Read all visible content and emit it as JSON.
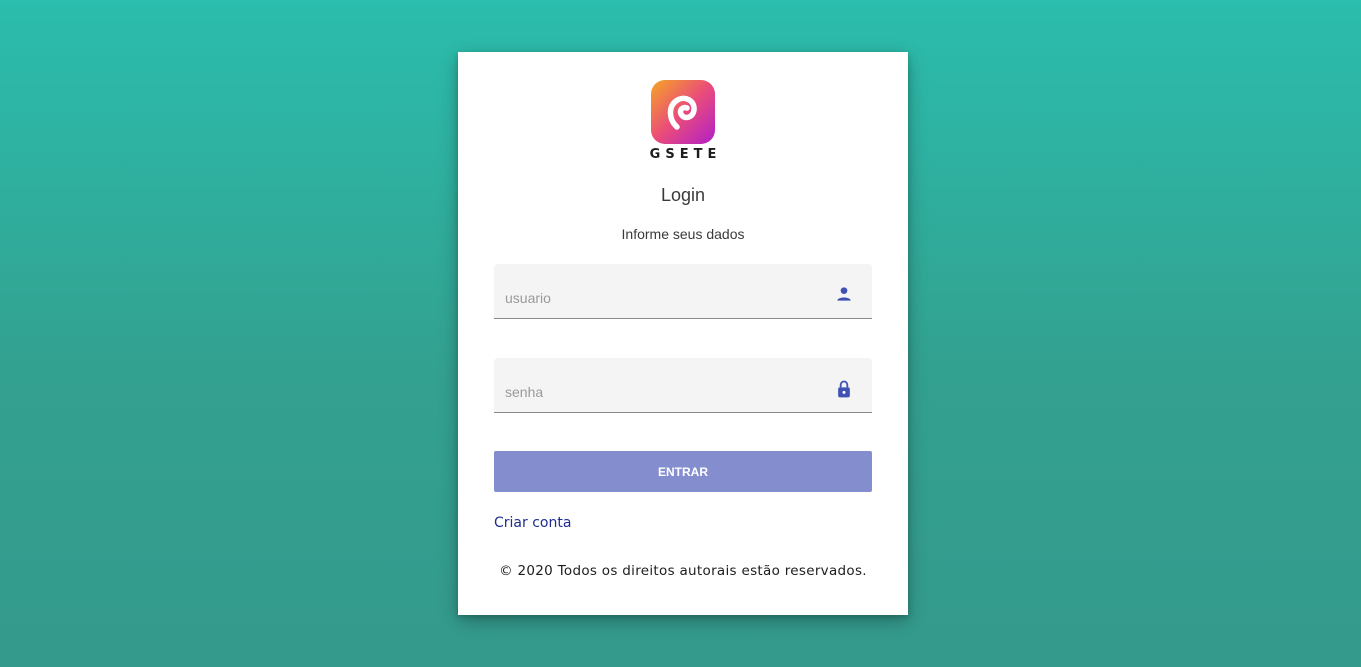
{
  "brand": {
    "name": "GSETE",
    "logo_icon": "gsete-logo-icon",
    "logo_gradient": [
      "#f5a623",
      "#ea4c7a",
      "#b11fc7"
    ]
  },
  "login": {
    "title": "Login",
    "subtitle": "Informe seus dados",
    "username": {
      "placeholder": "usuario",
      "value": "",
      "icon": "person-icon"
    },
    "password": {
      "placeholder": "senha",
      "value": "",
      "icon": "lock-icon"
    },
    "submit_label": "Entrar",
    "create_account_label": "Criar conta"
  },
  "footer": {
    "copyright": "© 2020 Todos os direitos autorais estão reservados."
  },
  "colors": {
    "background_top": "#2bbdad",
    "background_bottom": "#349a8c",
    "accent": "#3f51b5",
    "button": "#848ecf",
    "link": "#1f2d8f"
  }
}
